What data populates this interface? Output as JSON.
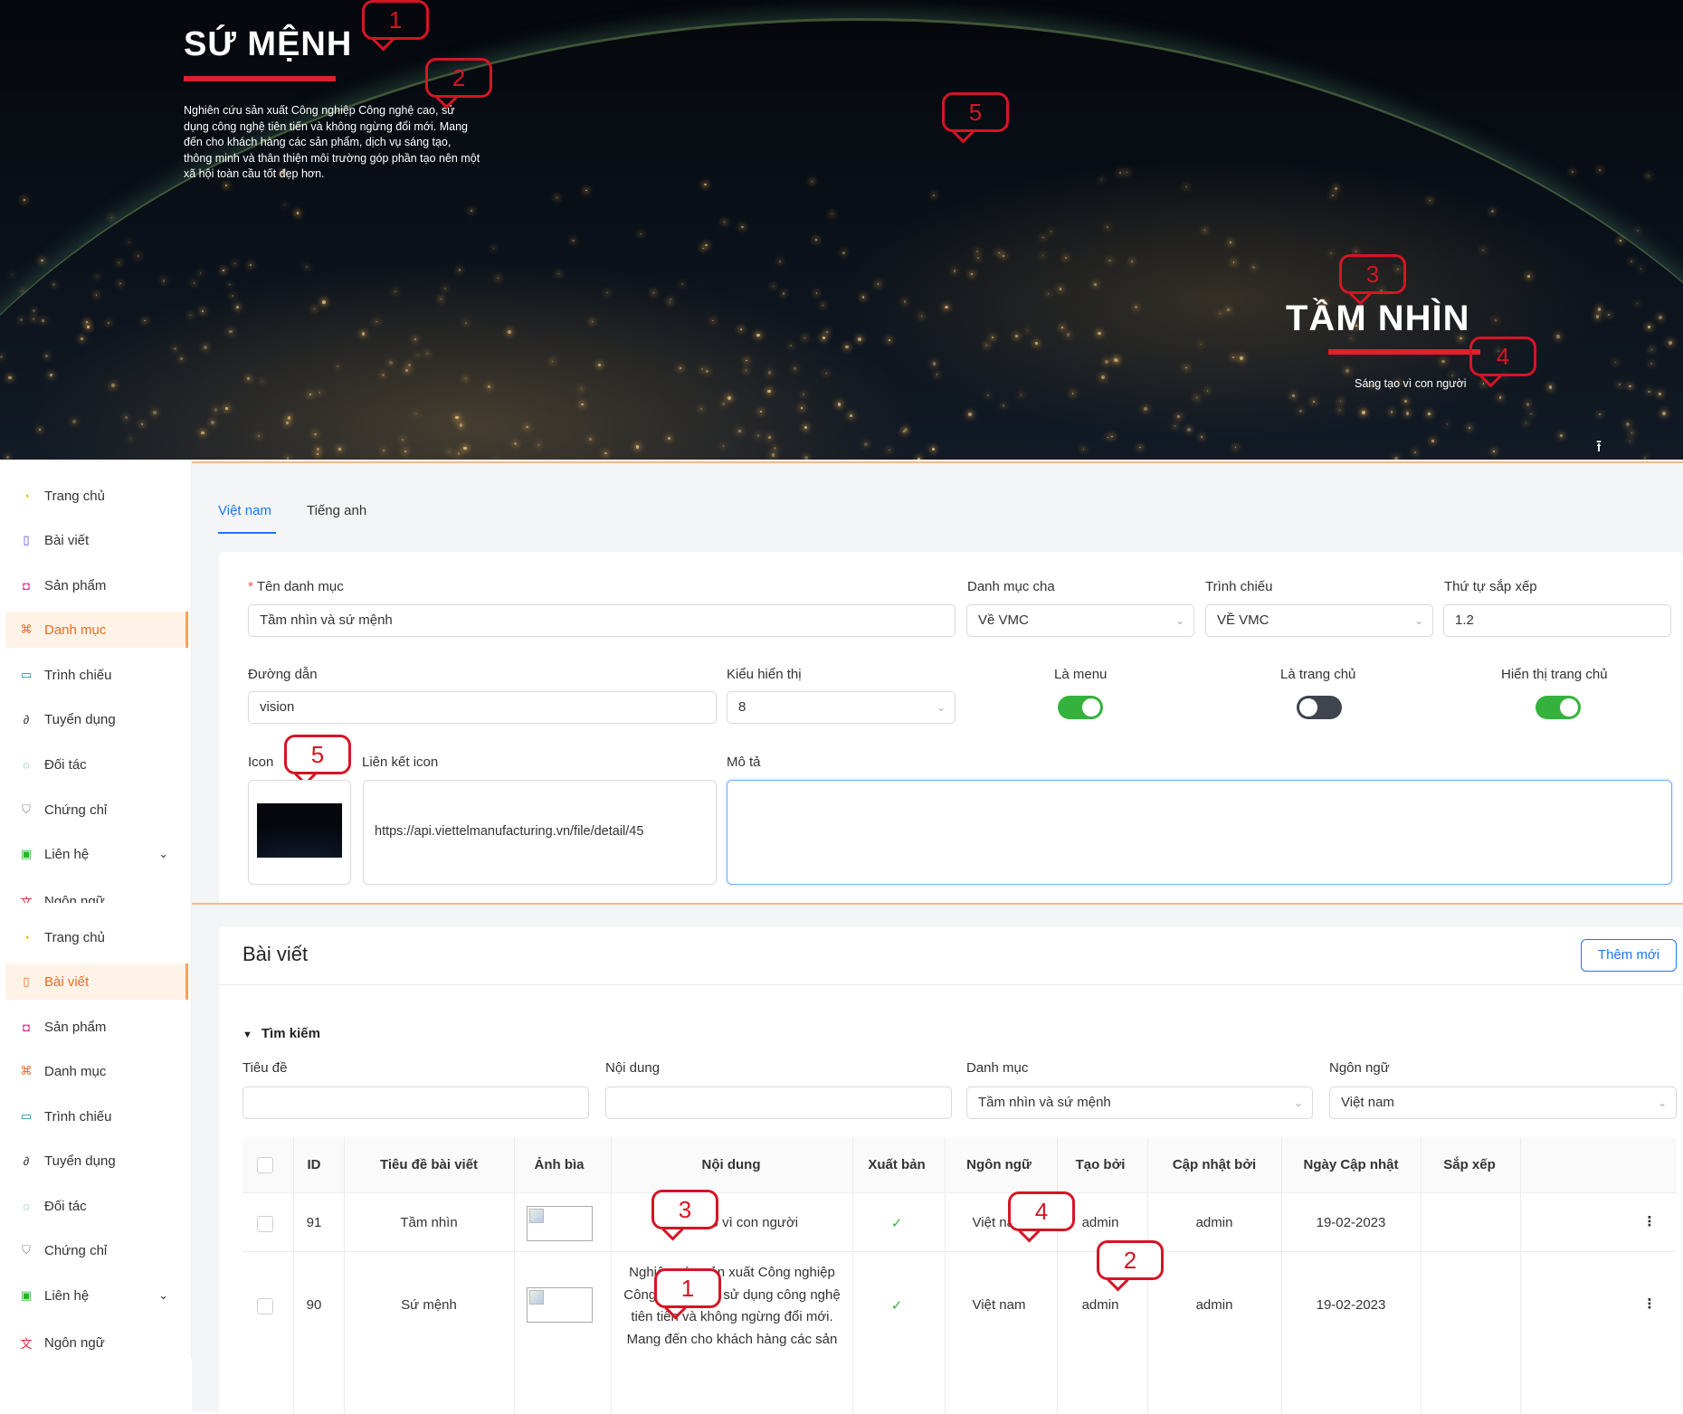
{
  "hero": {
    "mission_title": "SỨ MỆNH",
    "mission_text": "Nghiên cứu sản xuất Công nghiệp Công nghệ cao, sử dụng công nghệ tiên tiến và không ngừng đổi mới. Mang đến cho khách hàng các sản phẩm, dịch vụ sáng tạo, thông minh và thân thiện môi trường góp phần tạo nên một xã hội toàn cầu tốt đẹp hơn.",
    "vision_title": "TẦM NHÌN",
    "vision_text": "Sáng tạo vì con người",
    "scroll_top_icon": "arrow-up-to-line-icon",
    "markers": [
      "1",
      "2",
      "3",
      "4",
      "5"
    ]
  },
  "sidebar_top": {
    "items": [
      {
        "label": "Trang chủ",
        "icon": "dashboard-icon",
        "color": "#f5b301"
      },
      {
        "label": "Bài viết",
        "icon": "book-icon",
        "color": "#5b3ee8"
      },
      {
        "label": "Sản phẩm",
        "icon": "shopping-bag-icon",
        "color": "#e0298f"
      },
      {
        "label": "Danh mục",
        "icon": "sitemap-icon",
        "color": "#f06a1f",
        "active": true
      },
      {
        "label": "Trình chiếu",
        "icon": "monitor-icon",
        "color": "#0a8f9d"
      },
      {
        "label": "Tuyển dụng",
        "icon": "link-icon",
        "color": "#333333"
      },
      {
        "label": "Đối tác",
        "icon": "chat-icon",
        "color": "#1f9d55"
      },
      {
        "label": "Chứng chỉ",
        "icon": "shield-icon",
        "color": "#888888"
      },
      {
        "label": "Liên hệ",
        "icon": "contact-card-icon",
        "color": "#20b820"
      },
      {
        "label": "Ngôn ngữ",
        "icon": "translate-icon",
        "color": "#e0293d"
      }
    ]
  },
  "sidebar_bottom": {
    "items": [
      {
        "label": "Trang chủ",
        "icon": "dashboard-icon",
        "color": "#f5b301"
      },
      {
        "label": "Bài viết",
        "icon": "book-icon",
        "color": "#f06a1f",
        "active": true
      },
      {
        "label": "Sản phẩm",
        "icon": "shopping-bag-icon",
        "color": "#e0298f"
      },
      {
        "label": "Danh mục",
        "icon": "sitemap-icon",
        "color": "#f06a1f"
      },
      {
        "label": "Trình chiếu",
        "icon": "monitor-icon",
        "color": "#0a8f9d"
      },
      {
        "label": "Tuyển dụng",
        "icon": "link-icon",
        "color": "#333333"
      },
      {
        "label": "Đối tác",
        "icon": "chat-icon",
        "color": "#1f9d55"
      },
      {
        "label": "Chứng chỉ",
        "icon": "shield-icon",
        "color": "#888888"
      },
      {
        "label": "Liên hệ",
        "icon": "contact-card-icon",
        "color": "#20b820"
      },
      {
        "label": "Ngôn ngữ",
        "icon": "translate-icon",
        "color": "#e0293d"
      }
    ]
  },
  "form": {
    "tabs": [
      "Việt nam",
      "Tiếng anh"
    ],
    "name_label": "Tên danh mục",
    "name_value": "Tầm nhìn và sứ mệnh",
    "parent_label": "Danh mục cha",
    "parent_value": "Về VMC",
    "slideshow_label": "Trình chiếu",
    "slideshow_value": "VỀ VMC",
    "order_label": "Thứ tự sắp xếp",
    "order_value": "1.2",
    "path_label": "Đường dẫn",
    "path_value": "vision",
    "display_label": "Kiểu hiển thị",
    "display_value": "8",
    "is_menu_label": "Là menu",
    "is_menu": true,
    "is_home_label": "Là trang chủ",
    "is_home": false,
    "show_home_label": "Hiển thị trang chủ",
    "show_home": true,
    "icon_label": "Icon",
    "icon_marker": "5",
    "icon_link_label": "Liên kết icon",
    "icon_link_value": "https://api.viettelmanufacturing.vn/file/detail/45",
    "desc_label": "Mô tả",
    "desc_value": ""
  },
  "list": {
    "title": "Bài viết",
    "add_button": "Thêm mới",
    "search_toggle": "Tìm kiếm",
    "filters": {
      "title_label": "Tiêu đề",
      "title_value": "",
      "content_label": "Nội dung",
      "content_value": "",
      "category_label": "Danh mục",
      "category_value": "Tầm nhìn và sứ mệnh",
      "language_label": "Ngôn ngữ",
      "language_value": "Việt nam"
    },
    "columns": [
      "ID",
      "Tiêu đề bài viết",
      "Ảnh bìa",
      "Nội dung",
      "Xuất bản",
      "Ngôn ngữ",
      "Tạo bởi",
      "Cập nhật bởi",
      "Ngày Cập nhật",
      "Sắp xếp"
    ],
    "rows": [
      {
        "id": "91",
        "title": "Tầm nhìn",
        "content": "Sáng tạo vì con người",
        "published": "✓",
        "language": "Việt nam",
        "created_by": "admin",
        "updated_by": "admin",
        "updated_at": "19-02-2023",
        "sort": "",
        "title_marker": "3",
        "content_marker": "4"
      },
      {
        "id": "90",
        "title": "Sứ mệnh",
        "content": "Nghiên cứu sản xuất Công nghiệp Công nghệ cao, sử dụng công nghệ tiên tiến và không ngừng đổi mới. Mang đến cho khách hàng các sản phẩm, dịch vụ sáng ...",
        "published": "✓",
        "language": "Việt nam",
        "created_by": "admin",
        "updated_by": "admin",
        "updated_at": "19-02-2023",
        "sort": "",
        "title_marker": "1",
        "content_marker": "2"
      }
    ],
    "row_menu_icon": "more-vertical-icon"
  }
}
